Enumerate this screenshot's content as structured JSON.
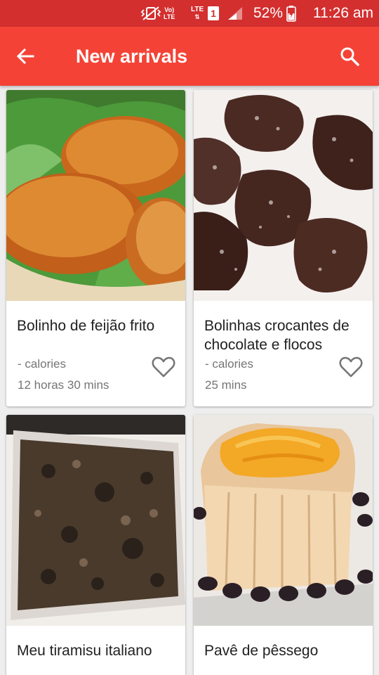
{
  "status_bar": {
    "network_label_top": "Vo)",
    "network_label_bottom": "LTE",
    "lte_label": "LTE",
    "sim_number": "1",
    "battery_percent": "52%",
    "time": "11:26 am"
  },
  "app_bar": {
    "title": "New arrivals",
    "back_icon": "arrow-back-icon",
    "search_icon": "search-icon"
  },
  "recipes": [
    {
      "name": "Bolinho de feijão frito",
      "calories": "- calories",
      "duration": "12 horas 30 mins",
      "image": "fried-bean-fritters"
    },
    {
      "name": "Bolinhas crocantes de chocolate e flocos",
      "calories": "- calories",
      "duration": "25 mins",
      "image": "chocolate-cornflake-clusters"
    },
    {
      "name": "Meu tiramisu italiano",
      "image": "tiramisu-dish"
    },
    {
      "name": "Pavê de pêssego",
      "image": "peach-pave"
    }
  ],
  "colors": {
    "status_bar": "#d32f2f",
    "app_bar": "#f44336",
    "background": "#eeeeee"
  }
}
